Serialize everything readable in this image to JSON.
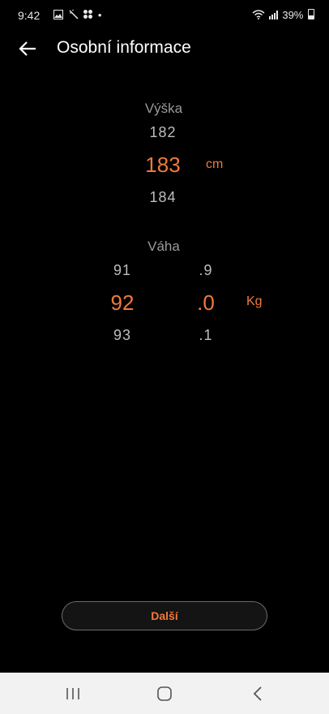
{
  "status_bar": {
    "time": "9:42",
    "battery": "39%",
    "icons": [
      "image-icon",
      "magic-wand-icon",
      "apps-icon",
      "dot-icon",
      "wifi-icon",
      "signal-icon",
      "battery-icon"
    ]
  },
  "header": {
    "title": "Osobní informace"
  },
  "height_picker": {
    "label": "Výška",
    "above": "182",
    "selected": "183",
    "below": "184",
    "unit": "cm"
  },
  "weight_picker": {
    "label": "Váha",
    "integer_above": "91",
    "integer_selected": "92",
    "integer_below": "93",
    "decimal_above": ".9",
    "decimal_selected": ".0",
    "decimal_below": ".1",
    "unit": "Kg"
  },
  "next_button": {
    "label": "Další"
  },
  "colors": {
    "accent": "#f07a3a",
    "background": "#000000",
    "navbar": "#f2f2f2"
  }
}
